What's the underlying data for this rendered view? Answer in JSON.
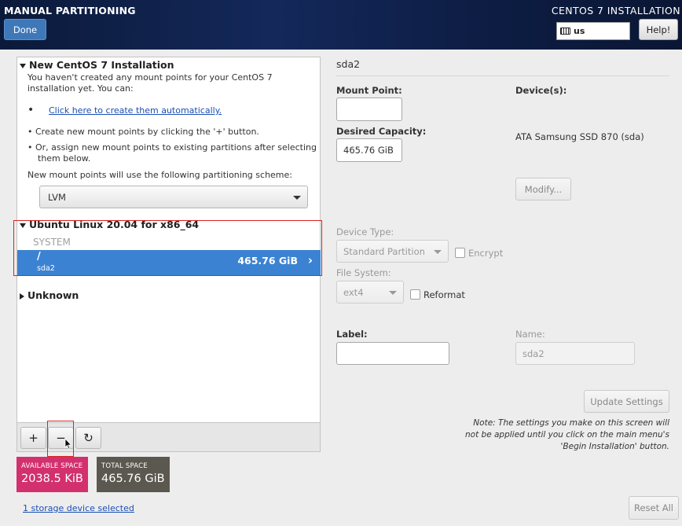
{
  "header": {
    "title": "MANUAL PARTITIONING",
    "product": "CENTOS 7 INSTALLATION",
    "done_label": "Done",
    "keyboard_layout": "us",
    "help_label": "Help!"
  },
  "new_install": {
    "title": "New CentOS 7 Installation",
    "intro": "You haven't created any mount points for your CentOS 7 installation yet.  You can:",
    "auto_link": "Click here to create them automatically.",
    "bullet1": "Create new mount points by clicking the '+' button.",
    "bullet2": "Or, assign new mount points to existing partitions after selecting them below.",
    "scheme_label": "New mount points will use the following partitioning scheme:",
    "scheme_value": "LVM"
  },
  "ubuntu": {
    "title": "Ubuntu Linux 20.04 for x86_64",
    "group": "SYSTEM",
    "mount": "/",
    "device": "sda2",
    "size": "465.76 GiB"
  },
  "unknown": {
    "title": "Unknown"
  },
  "toolbar": {
    "add": "+",
    "remove": "−",
    "refresh": "↻"
  },
  "space": {
    "available_label": "AVAILABLE SPACE",
    "available_value": "2038.5 KiB",
    "available_color": "#d3306e",
    "total_label": "TOTAL SPACE",
    "total_value": "465.76 GiB",
    "total_color": "#5b5850"
  },
  "storage_link": "1 storage device selected",
  "detail": {
    "title": "sda2",
    "mount_point_label": "Mount Point:",
    "mount_point_value": "",
    "capacity_label": "Desired Capacity:",
    "capacity_value": "465.76 GiB",
    "devices_label": "Device(s):",
    "device_name": "ATA Samsung SSD 870 (sda)",
    "modify_label": "Modify...",
    "device_type_label": "Device Type:",
    "device_type_value": "Standard Partition",
    "encrypt_label": "Encrypt",
    "filesystem_label": "File System:",
    "filesystem_value": "ext4",
    "reformat_label": "Reformat",
    "label_label": "Label:",
    "label_value": "",
    "name_label": "Name:",
    "name_value": "sda2",
    "update_label": "Update Settings",
    "note": "Note:  The settings you make on this screen will not be applied until you click on the main menu's 'Begin Installation' button.",
    "reset_label": "Reset All"
  }
}
